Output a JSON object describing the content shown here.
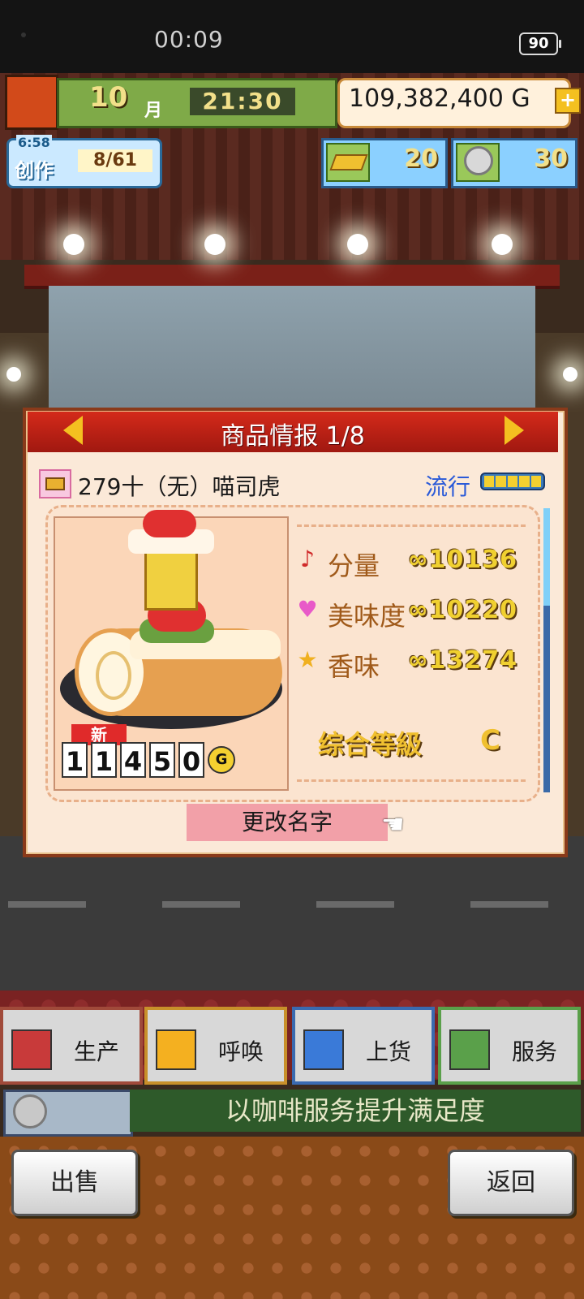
{
  "status_bar": {
    "time": "00:09",
    "battery": "90"
  },
  "hud": {
    "month": "10",
    "month_unit": "月",
    "time": "21:30",
    "money": "109,382,400",
    "money_unit": "G",
    "money_add": "+",
    "create_timer": "6:58",
    "create_label": "创作",
    "create_count": "8/61",
    "gold_count": "20",
    "silver_count": "30"
  },
  "panel": {
    "title": "商品情报 1/8",
    "product_name": "279十（无）喵司虎",
    "trend_label": "流行",
    "trend_level": 5,
    "new_tag": "新",
    "price_digits": [
      "1",
      "1",
      "4",
      "5",
      "0"
    ],
    "price_unit": "G",
    "stats": [
      {
        "icon": "♪",
        "label": "分量",
        "value": "∞10136"
      },
      {
        "icon": "♥",
        "label": "美味度",
        "value": "∞10220"
      },
      {
        "icon": "★",
        "label": "香味",
        "value": "∞13274"
      }
    ],
    "grade_label": "综合等級",
    "grade": "C",
    "rename_button": "更改名字"
  },
  "actions": {
    "produce": "生产",
    "call": "呼唤",
    "stock": "上货",
    "service": "服务"
  },
  "tip": "以咖啡服务提升满足度",
  "bottom": {
    "sell": "出售",
    "back": "返回"
  },
  "colors": {
    "panel_header": "#c42a1a",
    "trend": "#2a5ad8",
    "tip_bg": "#2e5a2a"
  }
}
